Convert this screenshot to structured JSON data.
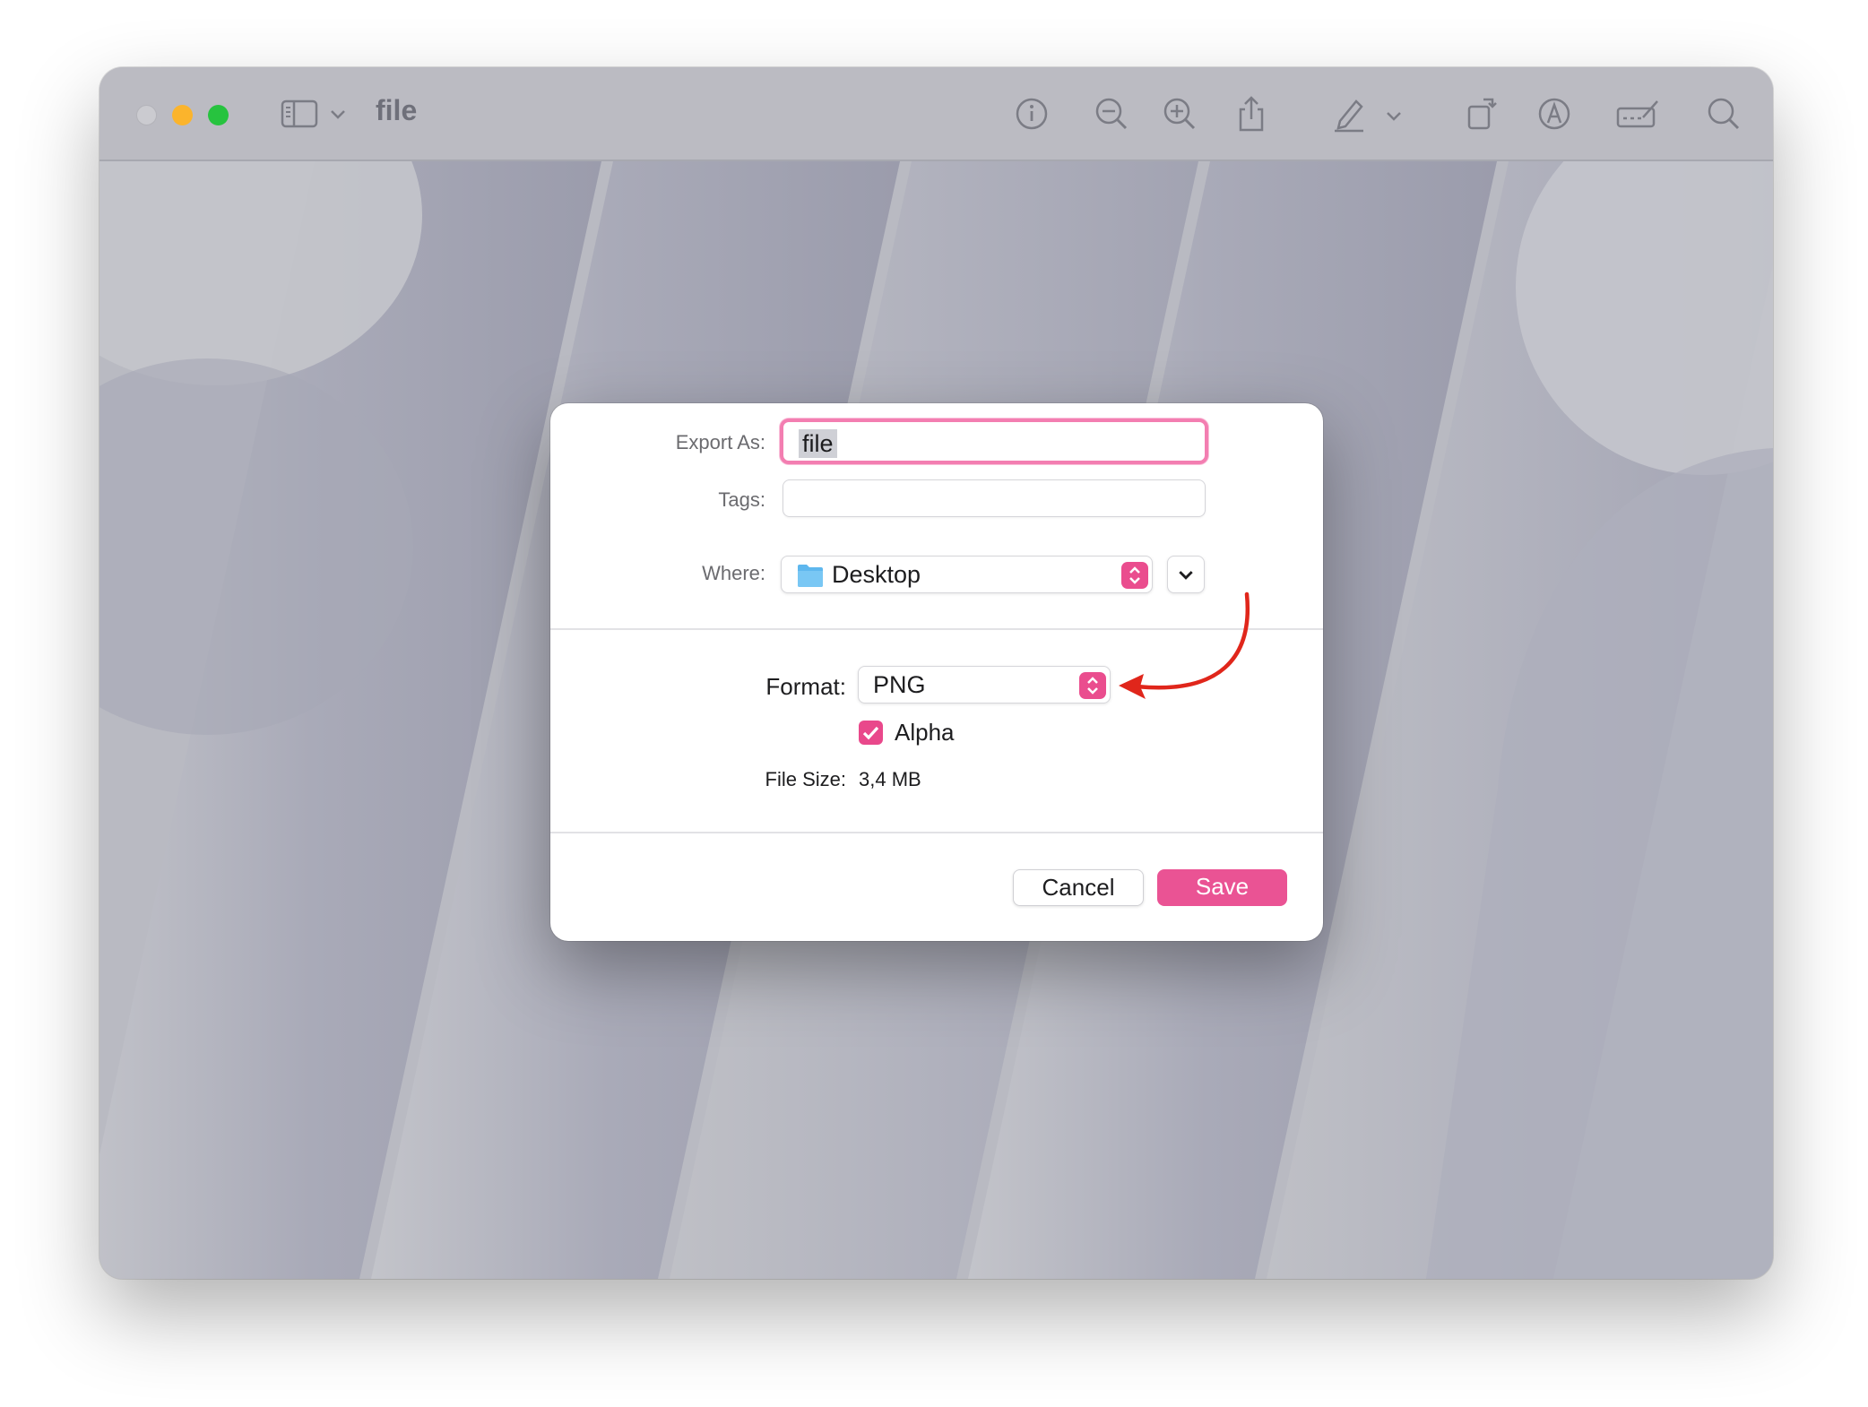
{
  "window": {
    "title": "file",
    "toolbar_icons": [
      "sidebar-icon",
      "chevron-down-icon",
      "info-icon",
      "zoom-out-icon",
      "zoom-in-icon",
      "share-icon",
      "highlight-pen-icon",
      "chevron-down-icon",
      "rotate-icon",
      "markup-icon",
      "form-fill-icon",
      "search-icon"
    ]
  },
  "dialog": {
    "export_as_label": "Export As:",
    "export_as_value": "file",
    "tags_label": "Tags:",
    "where_label": "Where:",
    "where_value": "Desktop",
    "format_label": "Format:",
    "format_value": "PNG",
    "alpha_label": "Alpha",
    "alpha_checked": true,
    "file_size_label": "File Size:",
    "file_size_value": "3,4 MB",
    "cancel_label": "Cancel",
    "save_label": "Save"
  },
  "colors": {
    "accent": "#ea4d8e",
    "annotation_arrow": "#e0261b"
  }
}
